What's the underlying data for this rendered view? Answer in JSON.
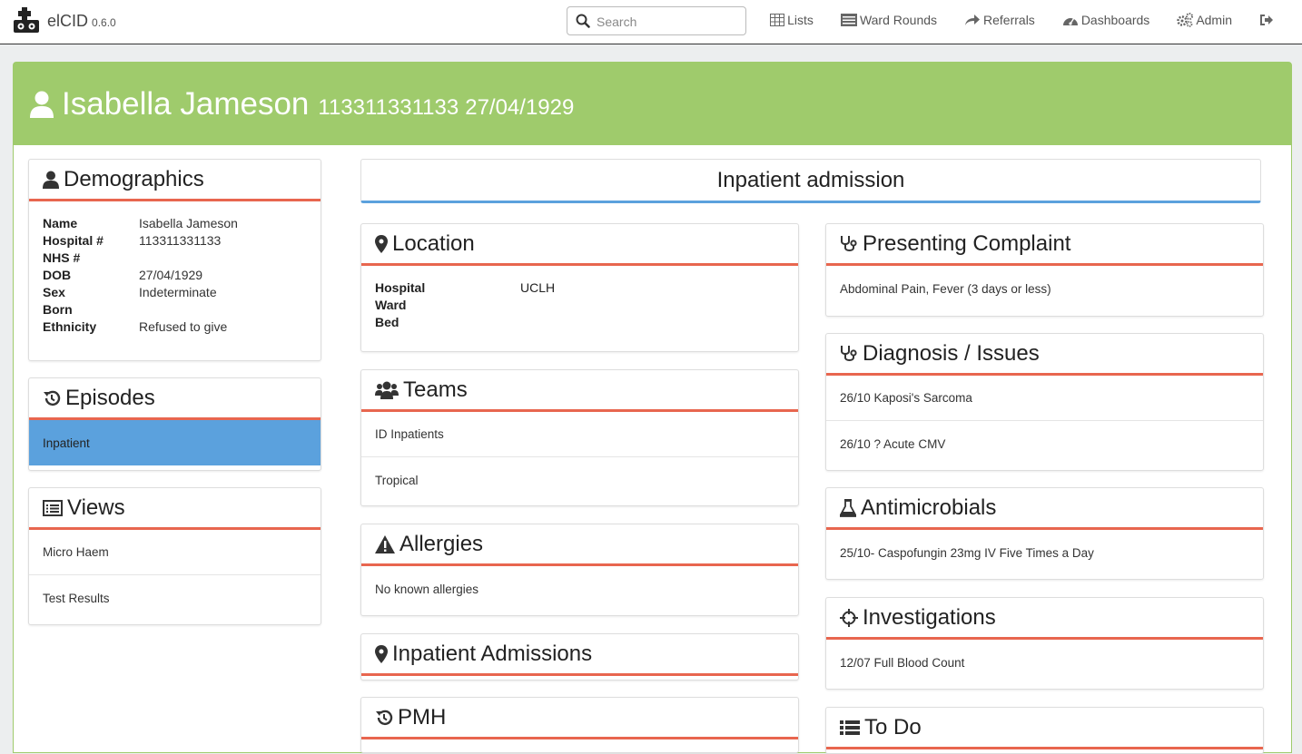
{
  "app": {
    "name": "elCID",
    "version": "0.6.0"
  },
  "search": {
    "placeholder": "Search"
  },
  "nav": {
    "lists": "Lists",
    "ward_rounds": "Ward Rounds",
    "referrals": "Referrals",
    "dashboards": "Dashboards",
    "admin": "Admin"
  },
  "patient": {
    "name": "Isabella Jameson",
    "hospital_number": "113311331133",
    "dob": "27/04/1929"
  },
  "demographics": {
    "title": "Demographics",
    "fields": [
      {
        "label": "Name",
        "value": "Isabella Jameson"
      },
      {
        "label": "Hospital #",
        "value": "113311331133"
      },
      {
        "label": "NHS #",
        "value": ""
      },
      {
        "label": "DOB",
        "value": "27/04/1929"
      },
      {
        "label": "Sex",
        "value": "Indeterminate"
      },
      {
        "label": "Born",
        "value": ""
      },
      {
        "label": "Ethnicity",
        "value": "Refused to give"
      }
    ]
  },
  "episodes": {
    "title": "Episodes",
    "items": [
      "Inpatient"
    ]
  },
  "views": {
    "title": "Views",
    "items": [
      "Micro Haem",
      "Test Results"
    ]
  },
  "admission": {
    "title": "Inpatient admission"
  },
  "location": {
    "title": "Location",
    "fields": [
      {
        "label": "Hospital",
        "value": "UCLH"
      },
      {
        "label": "Ward",
        "value": ""
      },
      {
        "label": "Bed",
        "value": ""
      }
    ]
  },
  "teams": {
    "title": "Teams",
    "items": [
      "ID Inpatients",
      "Tropical"
    ]
  },
  "allergies": {
    "title": "Allergies",
    "items": [
      "No known allergies"
    ]
  },
  "inpatient_admissions": {
    "title": "Inpatient Admissions"
  },
  "pmh": {
    "title": "PMH"
  },
  "presenting_complaint": {
    "title": "Presenting Complaint",
    "items": [
      "Abdominal Pain, Fever (3 days or less)"
    ]
  },
  "diagnosis": {
    "title": "Diagnosis / Issues",
    "items": [
      "26/10 Kaposi's Sarcoma",
      "26/10 ? Acute CMV"
    ]
  },
  "antimicrobials": {
    "title": "Antimicrobials",
    "items": [
      "25/10- Caspofungin 23mg IV Five Times a Day"
    ]
  },
  "investigations": {
    "title": "Investigations",
    "items": [
      "12/07 Full Blood Count"
    ]
  },
  "todo": {
    "title": "To Do"
  },
  "colors": {
    "header_green": "#9fcb6c",
    "accent_red": "#e8664f",
    "active_blue": "#5ba1dd"
  }
}
